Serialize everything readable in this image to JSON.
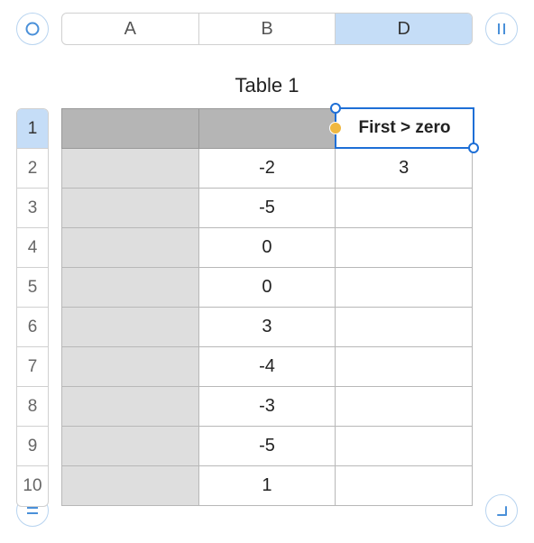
{
  "columns": [
    "A",
    "B",
    "D"
  ],
  "selected_column_index": 2,
  "rows": [
    "1",
    "2",
    "3",
    "4",
    "5",
    "6",
    "7",
    "8",
    "9",
    "10"
  ],
  "selected_row_index": 0,
  "title": "Table 1",
  "selected_cell": {
    "text": "First >  zero",
    "row": 0,
    "col": 2
  },
  "cells": {
    "b": [
      "",
      "-2",
      "-5",
      "0",
      "0",
      "3",
      "-4",
      "-3",
      "-5",
      "1"
    ],
    "d": [
      "",
      "3",
      "",
      "",
      "",
      "",
      "",
      "",
      "",
      ""
    ]
  },
  "icons": {
    "circle": "circle",
    "pause": "pause",
    "equals": "equals",
    "corner": "corner"
  }
}
